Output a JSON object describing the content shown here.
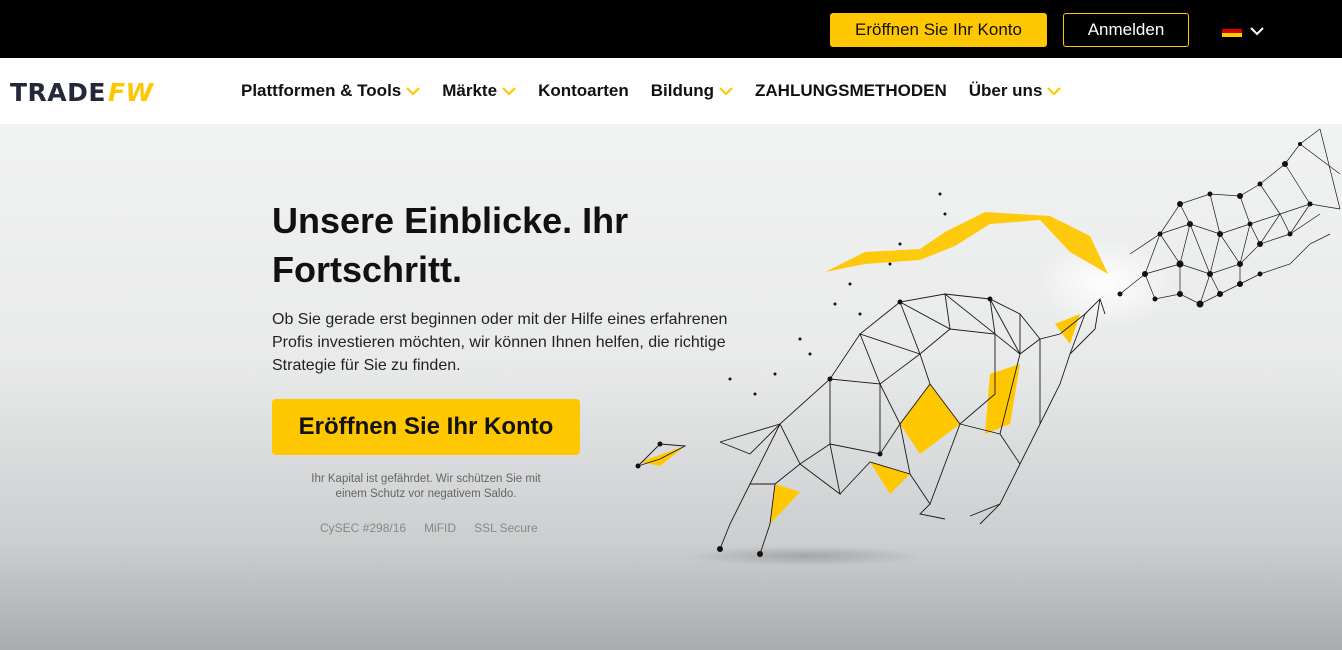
{
  "topbar": {
    "open_account_label": "Eröffnen Sie Ihr Konto",
    "login_label": "Anmelden",
    "language_icon": "germany-flag-icon",
    "accent_color": "#ffc700"
  },
  "logo": {
    "part1": "TRADE",
    "part2": "FW"
  },
  "nav": {
    "items": [
      {
        "label": "Plattformen & Tools",
        "has_dropdown": true
      },
      {
        "label": "Märkte",
        "has_dropdown": true
      },
      {
        "label": "Kontoarten",
        "has_dropdown": false
      },
      {
        "label": "Bildung",
        "has_dropdown": true
      },
      {
        "label": "ZAHLUNGSMETHODEN",
        "has_dropdown": false
      },
      {
        "label": "Über uns",
        "has_dropdown": true
      }
    ]
  },
  "hero": {
    "title": "Unsere Einblicke. Ihr Fortschritt.",
    "text": "Ob Sie gerade erst beginnen oder mit der Hilfe eines erfahrenen Profis investieren möchten, wir können Ihnen helfen, die richtige Strategie für Sie zu finden.",
    "cta_label": "Eröffnen Sie Ihr Konto",
    "risk_note": "Ihr Kapital ist gefährdet. Wir schützen Sie mit einem Schutz vor negativem Saldo.",
    "badges": [
      "CySEC #298/16",
      "MiFID",
      "SSL Secure"
    ]
  }
}
